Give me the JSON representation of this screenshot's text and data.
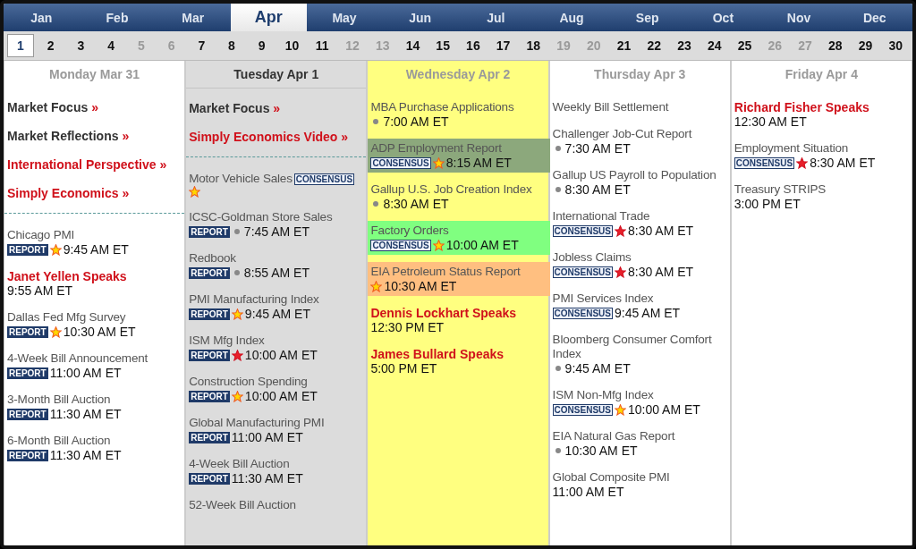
{
  "months": [
    {
      "label": "Jan",
      "selected": false
    },
    {
      "label": "Feb",
      "selected": false
    },
    {
      "label": "Mar",
      "selected": false
    },
    {
      "label": "Apr",
      "selected": true
    },
    {
      "label": "May",
      "selected": false
    },
    {
      "label": "Jun",
      "selected": false
    },
    {
      "label": "Jul",
      "selected": false
    },
    {
      "label": "Aug",
      "selected": false
    },
    {
      "label": "Sep",
      "selected": false
    },
    {
      "label": "Oct",
      "selected": false
    },
    {
      "label": "Nov",
      "selected": false
    },
    {
      "label": "Dec",
      "selected": false
    }
  ],
  "days": [
    {
      "label": "1",
      "selected": true,
      "weekend": false
    },
    {
      "label": "2",
      "selected": false,
      "weekend": false
    },
    {
      "label": "3",
      "selected": false,
      "weekend": false
    },
    {
      "label": "4",
      "selected": false,
      "weekend": false
    },
    {
      "label": "5",
      "selected": false,
      "weekend": true
    },
    {
      "label": "6",
      "selected": false,
      "weekend": true
    },
    {
      "label": "7",
      "selected": false,
      "weekend": false
    },
    {
      "label": "8",
      "selected": false,
      "weekend": false
    },
    {
      "label": "9",
      "selected": false,
      "weekend": false
    },
    {
      "label": "10",
      "selected": false,
      "weekend": false
    },
    {
      "label": "11",
      "selected": false,
      "weekend": false
    },
    {
      "label": "12",
      "selected": false,
      "weekend": true
    },
    {
      "label": "13",
      "selected": false,
      "weekend": true
    },
    {
      "label": "14",
      "selected": false,
      "weekend": false
    },
    {
      "label": "15",
      "selected": false,
      "weekend": false
    },
    {
      "label": "16",
      "selected": false,
      "weekend": false
    },
    {
      "label": "17",
      "selected": false,
      "weekend": false
    },
    {
      "label": "18",
      "selected": false,
      "weekend": false
    },
    {
      "label": "19",
      "selected": false,
      "weekend": true
    },
    {
      "label": "20",
      "selected": false,
      "weekend": true
    },
    {
      "label": "21",
      "selected": false,
      "weekend": false
    },
    {
      "label": "22",
      "selected": false,
      "weekend": false
    },
    {
      "label": "23",
      "selected": false,
      "weekend": false
    },
    {
      "label": "24",
      "selected": false,
      "weekend": false
    },
    {
      "label": "25",
      "selected": false,
      "weekend": false
    },
    {
      "label": "26",
      "selected": false,
      "weekend": true
    },
    {
      "label": "27",
      "selected": false,
      "weekend": true
    },
    {
      "label": "28",
      "selected": false,
      "weekend": false
    },
    {
      "label": "29",
      "selected": false,
      "weekend": false
    },
    {
      "label": "30",
      "selected": false,
      "weekend": false
    }
  ],
  "columns": [
    {
      "title": "Monday Mar 31",
      "current": false,
      "color": "#ffffff",
      "items": [
        {
          "kind": "link",
          "label": "Market Focus",
          "arrow": "»",
          "red": false
        },
        {
          "kind": "link",
          "label": "Market Reflections",
          "arrow": "»",
          "red": false
        },
        {
          "kind": "link",
          "label": "International Perspective",
          "arrow": "»",
          "red": true
        },
        {
          "kind": "link",
          "label": "Simply Economics",
          "arrow": "»",
          "red": true
        },
        {
          "kind": "divider"
        },
        {
          "kind": "event",
          "name": "Chicago PMI",
          "badge": {
            "text": "REPORT",
            "kind": "report"
          },
          "starred": true,
          "time": "9:45 AM ET"
        },
        {
          "kind": "speaker",
          "name": "Janet Yellen Speaks",
          "time": "9:55 AM ET"
        },
        {
          "kind": "event",
          "name": "Dallas Fed Mfg Survey",
          "badge": {
            "text": "REPORT",
            "kind": "report"
          },
          "starred": true,
          "time": "10:30 AM ET"
        },
        {
          "kind": "event",
          "name": "4-Week Bill Announcement",
          "badge": {
            "text": "REPORT",
            "kind": "report"
          },
          "time": "11:00 AM ET"
        },
        {
          "kind": "event",
          "name": "3-Month Bill Auction",
          "badge": {
            "text": "REPORT",
            "kind": "report"
          },
          "time": "11:30 AM ET"
        },
        {
          "kind": "event",
          "name": "6-Month Bill Auction",
          "badge": {
            "text": "REPORT",
            "kind": "report"
          },
          "time": "11:30 AM ET"
        }
      ]
    },
    {
      "title": "Tuesday Apr 1",
      "current": true,
      "color": "#dcdcdc",
      "items": [
        {
          "kind": "link",
          "label": "Market Focus",
          "arrow": "»",
          "red": false
        },
        {
          "kind": "link",
          "label": "Simply Economics Video",
          "arrow": "»",
          "red": true
        },
        {
          "kind": "divider"
        },
        {
          "kind": "event-inline",
          "name": "Motor Vehicle Sales",
          "badge": {
            "text": "CONSENSUS",
            "kind": "consensus"
          },
          "starred": true
        },
        {
          "kind": "event",
          "name": "ICSC-Goldman Store Sales",
          "badge": {
            "text": "REPORT",
            "kind": "report"
          },
          "bulleted": true,
          "time": "7:45 AM ET"
        },
        {
          "kind": "event",
          "name": "Redbook",
          "badge": {
            "text": "REPORT",
            "kind": "report"
          },
          "bulleted": true,
          "time": "8:55 AM ET"
        },
        {
          "kind": "event",
          "name": "PMI Manufacturing Index",
          "badge": {
            "text": "REPORT",
            "kind": "report"
          },
          "starred": true,
          "time": "9:45 AM ET"
        },
        {
          "kind": "event",
          "name": "ISM Mfg Index",
          "badge": {
            "text": "REPORT",
            "kind": "report"
          },
          "starred": true,
          "major": true,
          "time": "10:00 AM ET"
        },
        {
          "kind": "event",
          "name": "Construction Spending",
          "badge": {
            "text": "REPORT",
            "kind": "report"
          },
          "starred": true,
          "time": "10:00 AM ET"
        },
        {
          "kind": "event",
          "name": "Global Manufacturing PMI",
          "badge": {
            "text": "REPORT",
            "kind": "report"
          },
          "time": "11:00 AM ET"
        },
        {
          "kind": "event",
          "name": "4-Week Bill Auction",
          "badge": {
            "text": "REPORT",
            "kind": "report"
          },
          "time": "11:30 AM ET"
        },
        {
          "kind": "event",
          "name": "52-Week Bill Auction"
        }
      ]
    },
    {
      "title": "Wednesday Apr 2",
      "current": false,
      "color": "#ffff80",
      "items": [
        {
          "kind": "event",
          "name": "MBA Purchase Applications",
          "bulleted": true,
          "time": "7:00 AM ET"
        },
        {
          "kind": "event",
          "name": "ADP Employment Report",
          "badge": {
            "text": "CONSENSUS",
            "kind": "consensus"
          },
          "starred": true,
          "time": "8:15 AM ET",
          "color": "#8ca87c"
        },
        {
          "kind": "event",
          "name": "Gallup U.S. Job Creation Index",
          "bulleted": true,
          "time": "8:30 AM ET"
        },
        {
          "kind": "event",
          "name": "Factory Orders",
          "badge": {
            "text": "CONSENSUS",
            "kind": "consensus"
          },
          "starred": true,
          "time": "10:00 AM ET",
          "color": "#80ff80"
        },
        {
          "kind": "event",
          "name": "EIA Petroleum Status Report",
          "starred": true,
          "time": "10:30 AM ET",
          "color": "#ffbf80"
        },
        {
          "kind": "speaker",
          "name": "Dennis Lockhart Speaks",
          "time": "12:30 PM ET"
        },
        {
          "kind": "speaker",
          "name": "James Bullard Speaks",
          "time": "5:00 PM ET"
        }
      ]
    },
    {
      "title": "Thursday Apr 3",
      "current": false,
      "color": "#ffffff",
      "items": [
        {
          "kind": "event",
          "name": "Weekly Bill Settlement"
        },
        {
          "kind": "event",
          "name": "Challenger Job-Cut Report",
          "bulleted": true,
          "time": "7:30 AM ET"
        },
        {
          "kind": "event",
          "name": "Gallup US Payroll to Population",
          "bulleted": true,
          "time": "8:30 AM ET"
        },
        {
          "kind": "event",
          "name": "International Trade",
          "badge": {
            "text": "CONSENSUS",
            "kind": "consensus"
          },
          "starred": true,
          "major": true,
          "time": "8:30 AM ET"
        },
        {
          "kind": "event",
          "name": "Jobless Claims",
          "badge": {
            "text": "CONSENSUS",
            "kind": "consensus"
          },
          "starred": true,
          "major": true,
          "time": "8:30 AM ET"
        },
        {
          "kind": "event",
          "name": "PMI Services Index",
          "badge": {
            "text": "CONSENSUS",
            "kind": "consensus"
          },
          "time": "9:45 AM ET"
        },
        {
          "kind": "event",
          "name": "Bloomberg Consumer Comfort Index",
          "bulleted": true,
          "time": "9:45 AM ET"
        },
        {
          "kind": "event",
          "name": "ISM Non-Mfg Index",
          "badge": {
            "text": "CONSENSUS",
            "kind": "consensus"
          },
          "starred": true,
          "time": "10:00 AM ET"
        },
        {
          "kind": "event",
          "name": "EIA Natural Gas Report",
          "bulleted": true,
          "time": "10:30 AM ET"
        },
        {
          "kind": "event",
          "name": "Global Composite PMI",
          "time": "11:00 AM ET"
        }
      ]
    },
    {
      "title": "Friday Apr 4",
      "current": false,
      "color": "#ffffff",
      "items": [
        {
          "kind": "speaker",
          "name": "Richard Fisher Speaks",
          "time": "12:30 AM ET"
        },
        {
          "kind": "event",
          "name": "Employment Situation",
          "badge": {
            "text": "CONSENSUS",
            "kind": "consensus"
          },
          "starred": true,
          "major": true,
          "time": "8:30 AM ET"
        },
        {
          "kind": "event",
          "name": "Treasury STRIPS",
          "time": "3:00 PM ET"
        }
      ]
    }
  ]
}
